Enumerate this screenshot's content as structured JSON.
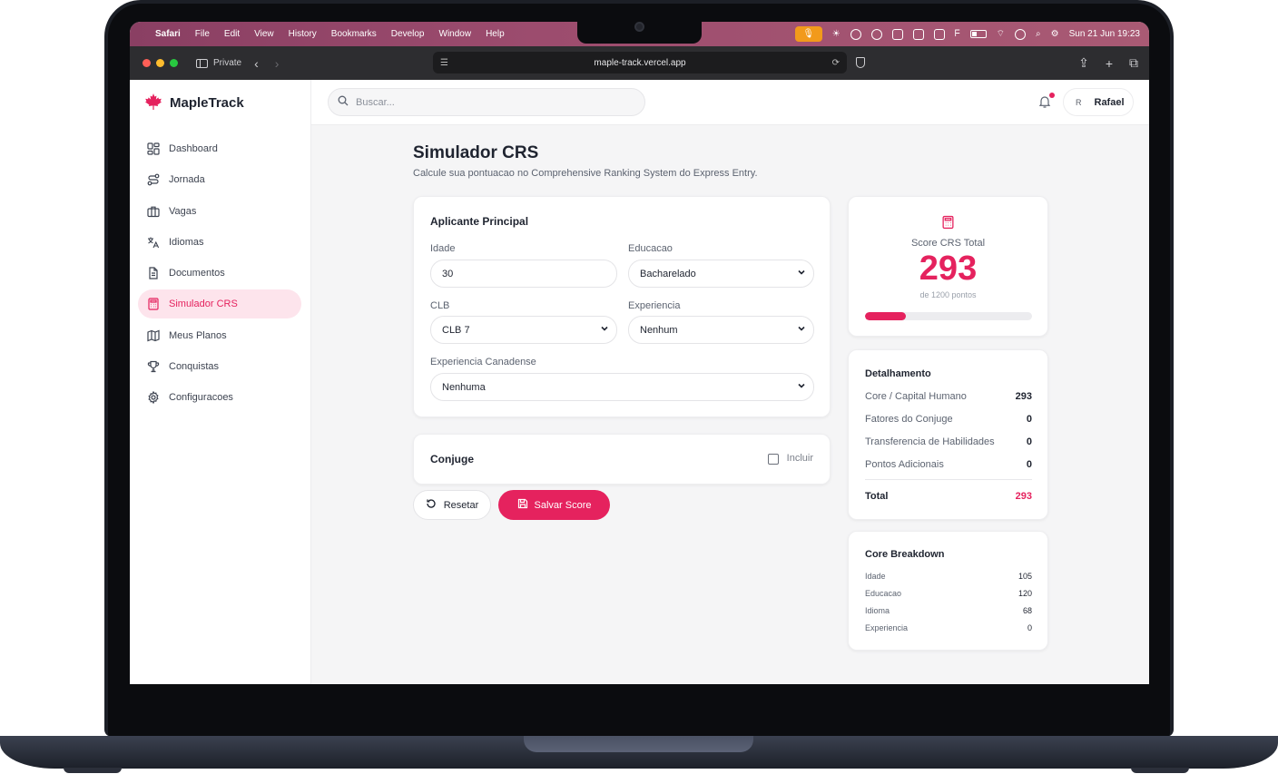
{
  "menubar": {
    "app": "Safari",
    "items": [
      "File",
      "Edit",
      "View",
      "History",
      "Bookmarks",
      "Develop",
      "Window",
      "Help"
    ],
    "clock": "Sun 21 Jun  19:23"
  },
  "browser": {
    "private_label": "Private",
    "url": "maple-track.vercel.app"
  },
  "app": {
    "brand": "MapleTrack",
    "accent": "#e5225e",
    "search_placeholder": "Buscar...",
    "user": {
      "initial": "R",
      "name": "Rafael"
    },
    "nav": [
      {
        "label": "Dashboard",
        "icon": "dashboard-icon",
        "active": false
      },
      {
        "label": "Jornada",
        "icon": "route-icon",
        "active": false
      },
      {
        "label": "Vagas",
        "icon": "briefcase-icon",
        "active": false
      },
      {
        "label": "Idiomas",
        "icon": "language-icon",
        "active": false
      },
      {
        "label": "Documentos",
        "icon": "document-icon",
        "active": false
      },
      {
        "label": "Simulador CRS",
        "icon": "calculator-icon",
        "active": true
      },
      {
        "label": "Meus Planos",
        "icon": "map-icon",
        "active": false
      },
      {
        "label": "Conquistas",
        "icon": "trophy-icon",
        "active": false
      },
      {
        "label": "Configuracoes",
        "icon": "gear-icon",
        "active": false
      }
    ]
  },
  "page": {
    "title": "Simulador CRS",
    "subtitle": "Calcule sua pontuacao no Comprehensive Ranking System do Express Entry."
  },
  "applicant": {
    "title": "Aplicante Principal",
    "age_label": "Idade",
    "age_value": "30",
    "education_label": "Educacao",
    "education_value": "Bacharelado",
    "clb_label": "CLB",
    "clb_value": "CLB 7",
    "experience_label": "Experiencia",
    "experience_value": "Nenhum",
    "canadian_label": "Experiencia Canadense",
    "canadian_value": "Nenhuma"
  },
  "spouse": {
    "title": "Conjuge",
    "include_label": "Incluir",
    "include_checked": false
  },
  "actions": {
    "reset_label": "Resetar",
    "save_label": "Salvar Score"
  },
  "score": {
    "label": "Score CRS Total",
    "value": "293",
    "sub": "de 1200 pontos",
    "progress_fraction": 0.244
  },
  "details": {
    "title": "Detalhamento",
    "rows": [
      {
        "label": "Core / Capital Humano",
        "value": "293"
      },
      {
        "label": "Fatores do Conjuge",
        "value": "0"
      },
      {
        "label": "Transferencia de Habilidades",
        "value": "0"
      },
      {
        "label": "Pontos Adicionais",
        "value": "0"
      }
    ],
    "total_label": "Total",
    "total_value": "293"
  },
  "core": {
    "title": "Core Breakdown",
    "rows": [
      {
        "label": "Idade",
        "value": "105"
      },
      {
        "label": "Educacao",
        "value": "120"
      },
      {
        "label": "Idioma",
        "value": "68"
      },
      {
        "label": "Experiencia",
        "value": "0"
      }
    ]
  }
}
